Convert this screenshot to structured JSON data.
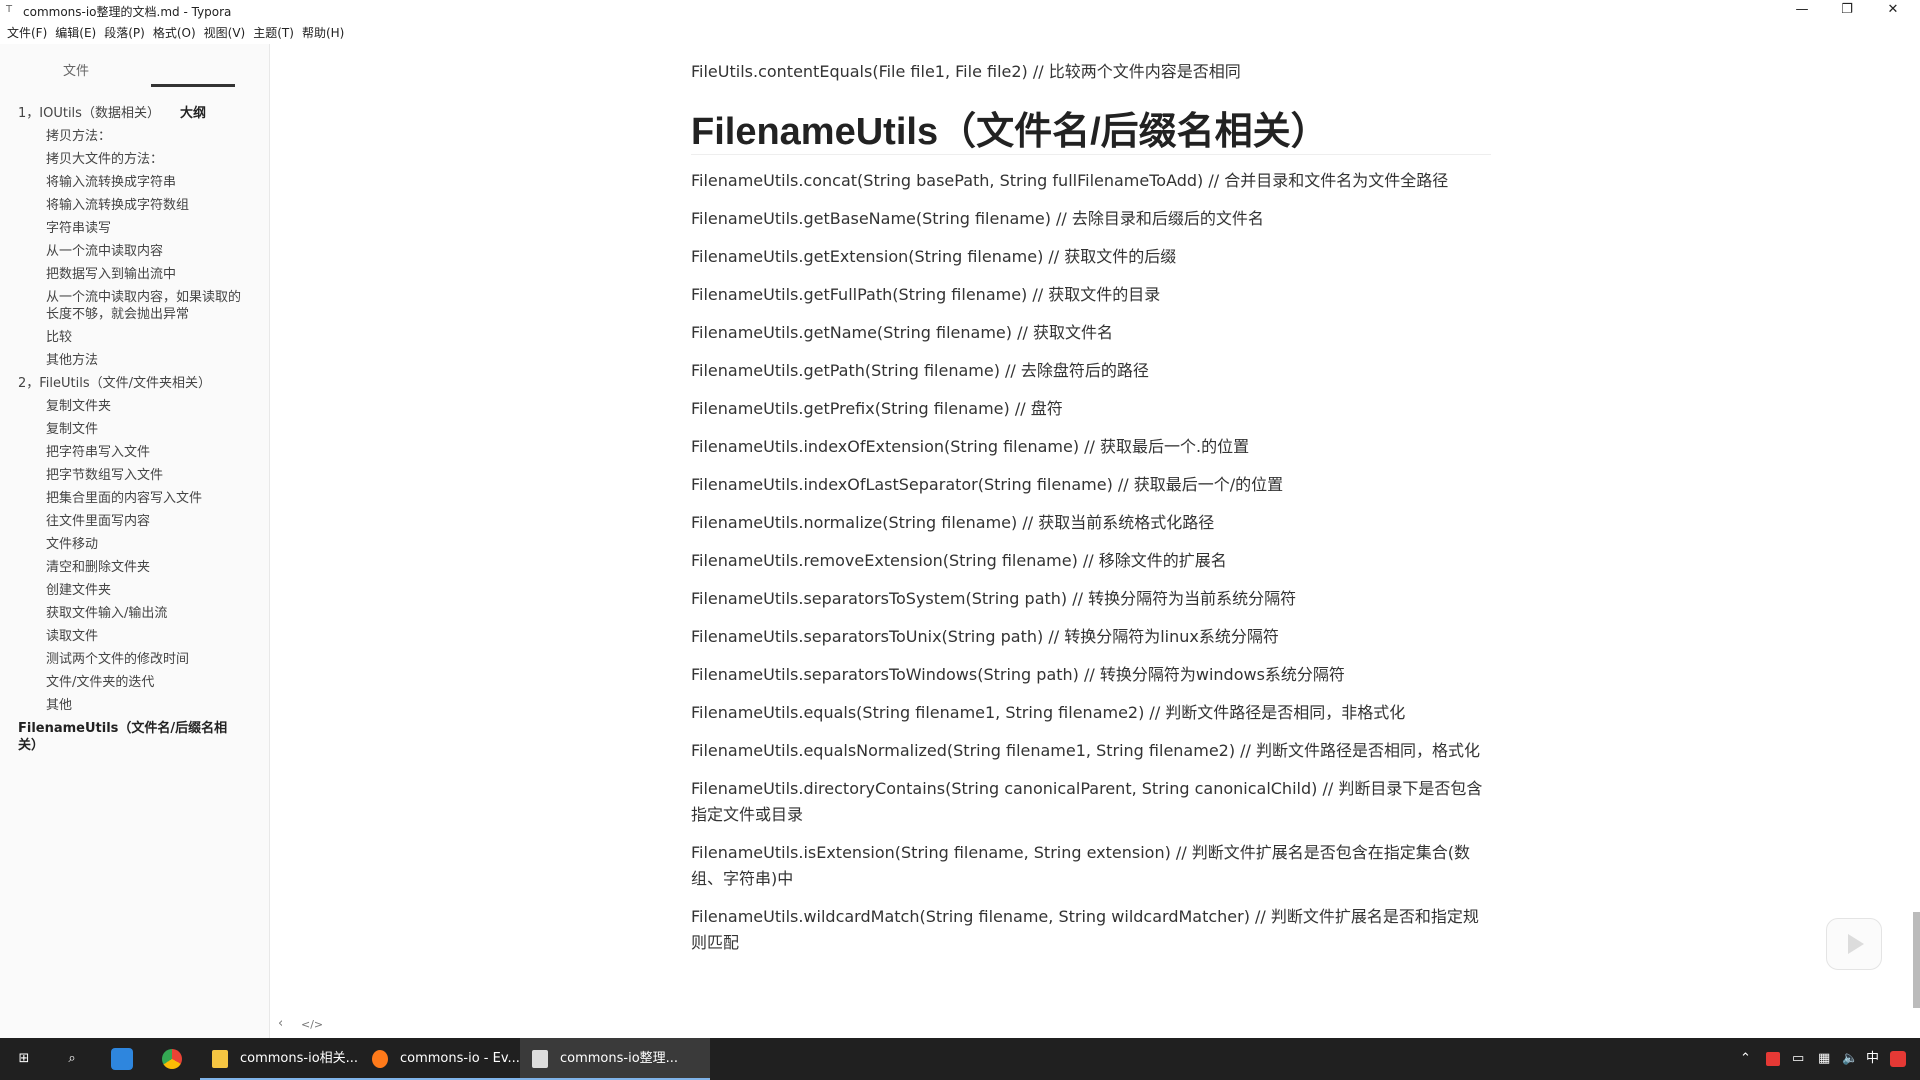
{
  "window": {
    "title": "commons-io整理的文档.md - Typora"
  },
  "menu": [
    "文件(F)",
    "编辑(E)",
    "段落(P)",
    "格式(O)",
    "视图(V)",
    "主题(T)",
    "帮助(H)"
  ],
  "sidebar": {
    "tabs": {
      "files": "文件",
      "outline": "大纲"
    },
    "outline": [
      {
        "level": 1,
        "label": "1，IOUtils（数据相关）"
      },
      {
        "level": 2,
        "label": "拷贝方法："
      },
      {
        "level": 2,
        "label": "拷贝大文件的方法："
      },
      {
        "level": 2,
        "label": "将输入流转换成字符串"
      },
      {
        "level": 2,
        "label": "将输入流转换成字符数组"
      },
      {
        "level": 2,
        "label": "字符串读写"
      },
      {
        "level": 2,
        "label": "从一个流中读取内容"
      },
      {
        "level": 2,
        "label": "把数据写入到输出流中"
      },
      {
        "level": 2,
        "label": "从一个流中读取内容，如果读取的长度不够，就会抛出异常",
        "wrap": true
      },
      {
        "level": 2,
        "label": "比较"
      },
      {
        "level": 2,
        "label": "其他方法"
      },
      {
        "level": 1,
        "label": "2，FileUtils（文件/文件夹相关）"
      },
      {
        "level": 2,
        "label": "复制文件夹"
      },
      {
        "level": 2,
        "label": "复制文件"
      },
      {
        "level": 2,
        "label": "把字符串写入文件"
      },
      {
        "level": 2,
        "label": "把字节数组写入文件"
      },
      {
        "level": 2,
        "label": "把集合里面的内容写入文件"
      },
      {
        "level": 2,
        "label": "往文件里面写内容"
      },
      {
        "level": 2,
        "label": "文件移动"
      },
      {
        "level": 2,
        "label": "清空和删除文件夹"
      },
      {
        "level": 2,
        "label": "创建文件夹"
      },
      {
        "level": 2,
        "label": "获取文件输入/输出流"
      },
      {
        "level": 2,
        "label": "读取文件"
      },
      {
        "level": 2,
        "label": "测试两个文件的修改时间"
      },
      {
        "level": 2,
        "label": "文件/文件夹的迭代"
      },
      {
        "level": 2,
        "label": "其他"
      },
      {
        "level": 1,
        "label": "FilenameUtils（文件名/后缀名相关）",
        "active": true
      }
    ],
    "footer": {
      "collapse": "‹",
      "source": "</>"
    }
  },
  "content": {
    "top_line": "FileUtils.contentEquals(File file1, File file2) // 比较两个文件内容是否相同",
    "heading": "FilenameUtils（文件名/后缀名相关）",
    "lines": [
      "FilenameUtils.concat(String basePath, String fullFilenameToAdd) // 合并目录和文件名为文件全路径",
      "FilenameUtils.getBaseName(String filename) // 去除目录和后缀后的文件名",
      "FilenameUtils.getExtension(String filename) // 获取文件的后缀",
      "FilenameUtils.getFullPath(String filename) // 获取文件的目录",
      "FilenameUtils.getName(String filename) // 获取文件名",
      "FilenameUtils.getPath(String filename) // 去除盘符后的路径",
      "FilenameUtils.getPrefix(String filename) // 盘符",
      "FilenameUtils.indexOfExtension(String filename) // 获取最后一个.的位置",
      "FilenameUtils.indexOfLastSeparator(String filename) // 获取最后一个/的位置",
      "FilenameUtils.normalize(String filename) // 获取当前系统格式化路径",
      "FilenameUtils.removeExtension(String filename) // 移除文件的扩展名",
      "FilenameUtils.separatorsToSystem(String path) // 转换分隔符为当前系统分隔符",
      "FilenameUtils.separatorsToUnix(String path) // 转换分隔符为linux系统分隔符",
      "FilenameUtils.separatorsToWindows(String path) // 转换分隔符为windows系统分隔符",
      "FilenameUtils.equals(String filename1, String filename2) // 判断文件路径是否相同，非格式化",
      "FilenameUtils.equalsNormalized(String filename1, String filename2) // 判断文件路径是否相同，格式化",
      "FilenameUtils.directoryContains(String canonicalParent, String canonicalChild) // 判断目录下是否包含指定文件或目录",
      "FilenameUtils.isExtension(String filename, String extension) // 判断文件扩展名是否包含在指定集合(数组、字符串)中",
      "FilenameUtils.wildcardMatch(String filename, String wildcardMatcher) // 判断文件扩展名是否和指定规则匹配"
    ]
  },
  "taskbar": {
    "apps": [
      {
        "label": "commons-io相关...",
        "color": "#f5c542"
      },
      {
        "label": "commons-io - Ev...",
        "color": "#ff7a1a"
      },
      {
        "label": "commons-io整理...",
        "color": "#ffffff",
        "active": true
      }
    ],
    "tray": {
      "ime": "中"
    }
  }
}
